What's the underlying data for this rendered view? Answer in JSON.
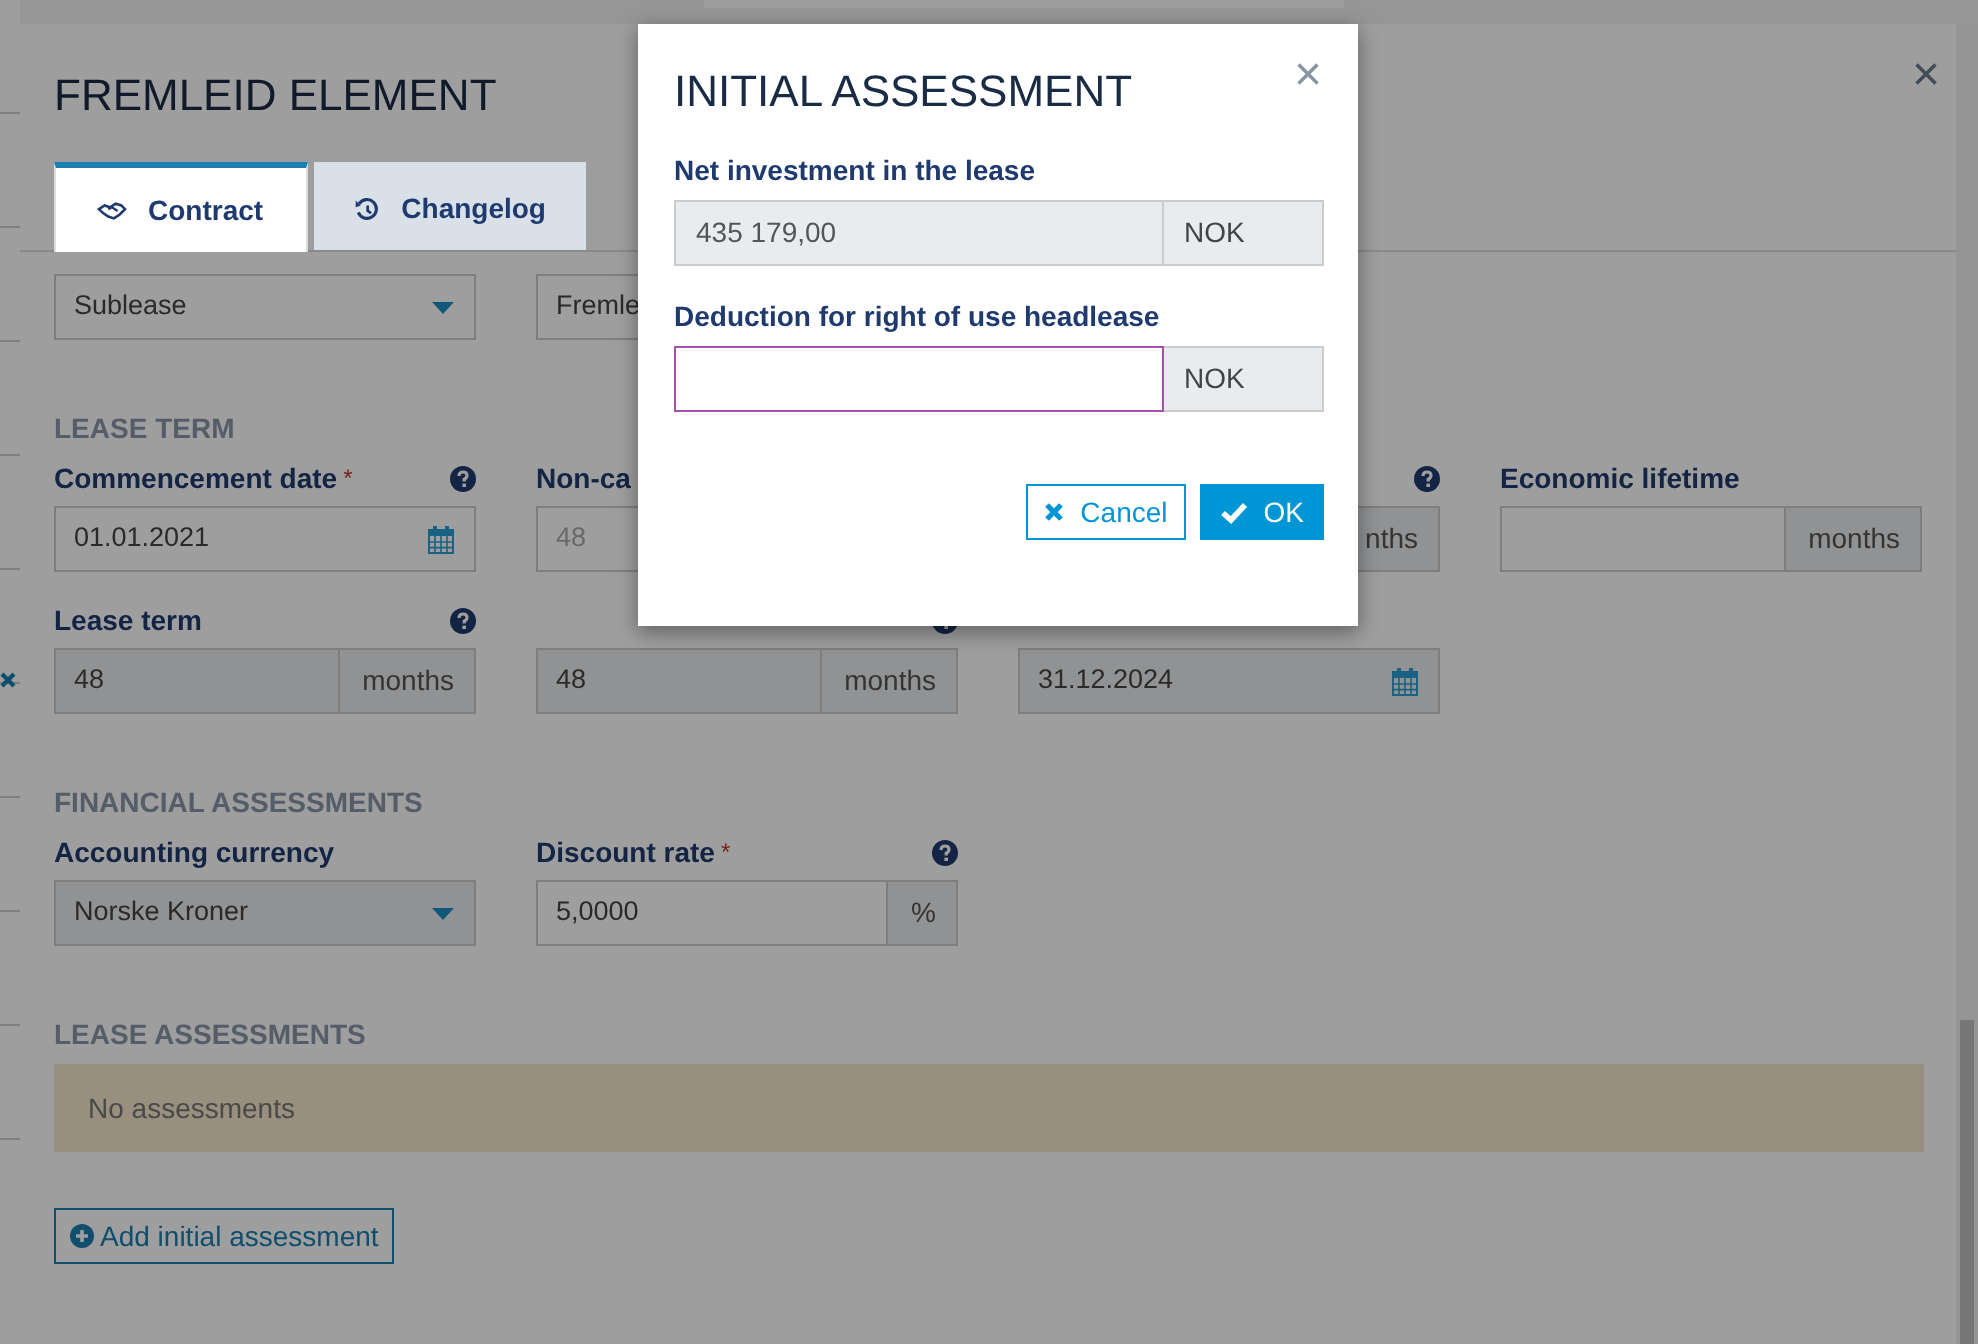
{
  "modal": {
    "title": "FREMLEID ELEMENT",
    "close": "×",
    "tabs": [
      {
        "label": "Contract",
        "selected": true
      },
      {
        "label": "Changelog",
        "selected": false
      }
    ],
    "sections": [
      {
        "rows": [
          [
            {
              "control": {
                "kind": "select",
                "value": "Sublease"
              }
            },
            {
              "control": {
                "kind": "text",
                "value": "Fremle"
              }
            }
          ]
        ]
      },
      {
        "heading": "LEASE TERM",
        "rows": [
          [
            {
              "label": "Commencement date",
              "required_mark": "*",
              "help": true,
              "control": {
                "kind": "date",
                "value": "01.01.2021"
              }
            },
            {
              "label": "Non-ca",
              "control": {
                "kind": "text",
                "placeholder": "48"
              }
            },
            {
              "help": true,
              "control": {
                "kind": "addon",
                "suffix": "nths"
              }
            },
            {
              "label": "Economic lifetime",
              "control": {
                "kind": "text",
                "suffix": "months"
              }
            }
          ],
          [
            {
              "label": "Lease term",
              "help": true,
              "control": {
                "kind": "text",
                "value": "48",
                "suffix": "months",
                "disabled": true
              }
            },
            {
              "help": true,
              "control": {
                "kind": "text",
                "value": "48",
                "suffix": "months",
                "disabled": true
              }
            },
            {
              "control": {
                "kind": "date",
                "value": "31.12.2024",
                "disabled": true
              }
            }
          ]
        ]
      },
      {
        "heading": "FINANCIAL ASSESSMENTS",
        "rows": [
          [
            {
              "label": "Accounting currency",
              "control": {
                "kind": "select",
                "value": "Norske Kroner",
                "disabled": true
              }
            },
            {
              "label": "Discount rate",
              "required_mark": "*",
              "help": true,
              "control": {
                "kind": "text",
                "value": "5,0000",
                "suffix": "%"
              }
            }
          ]
        ]
      }
    ],
    "assessments": {
      "heading": "LEASE ASSESSMENTS",
      "empty_text": "No assessments"
    },
    "add_button": "Add initial assessment"
  },
  "dialog": {
    "title": "INITIAL ASSESSMENT",
    "close": "×",
    "fields": [
      {
        "label": "Net investment in the lease",
        "value": "435 179,00",
        "suffix": "NOK",
        "readonly": true,
        "focused": false
      },
      {
        "label": "Deduction for right of use headlease",
        "suffix": "NOK",
        "readonly": false,
        "focused": true
      }
    ],
    "buttons": [
      {
        "label": "Cancel",
        "kind": "outline"
      },
      {
        "label": "OK",
        "kind": "primary"
      }
    ]
  }
}
